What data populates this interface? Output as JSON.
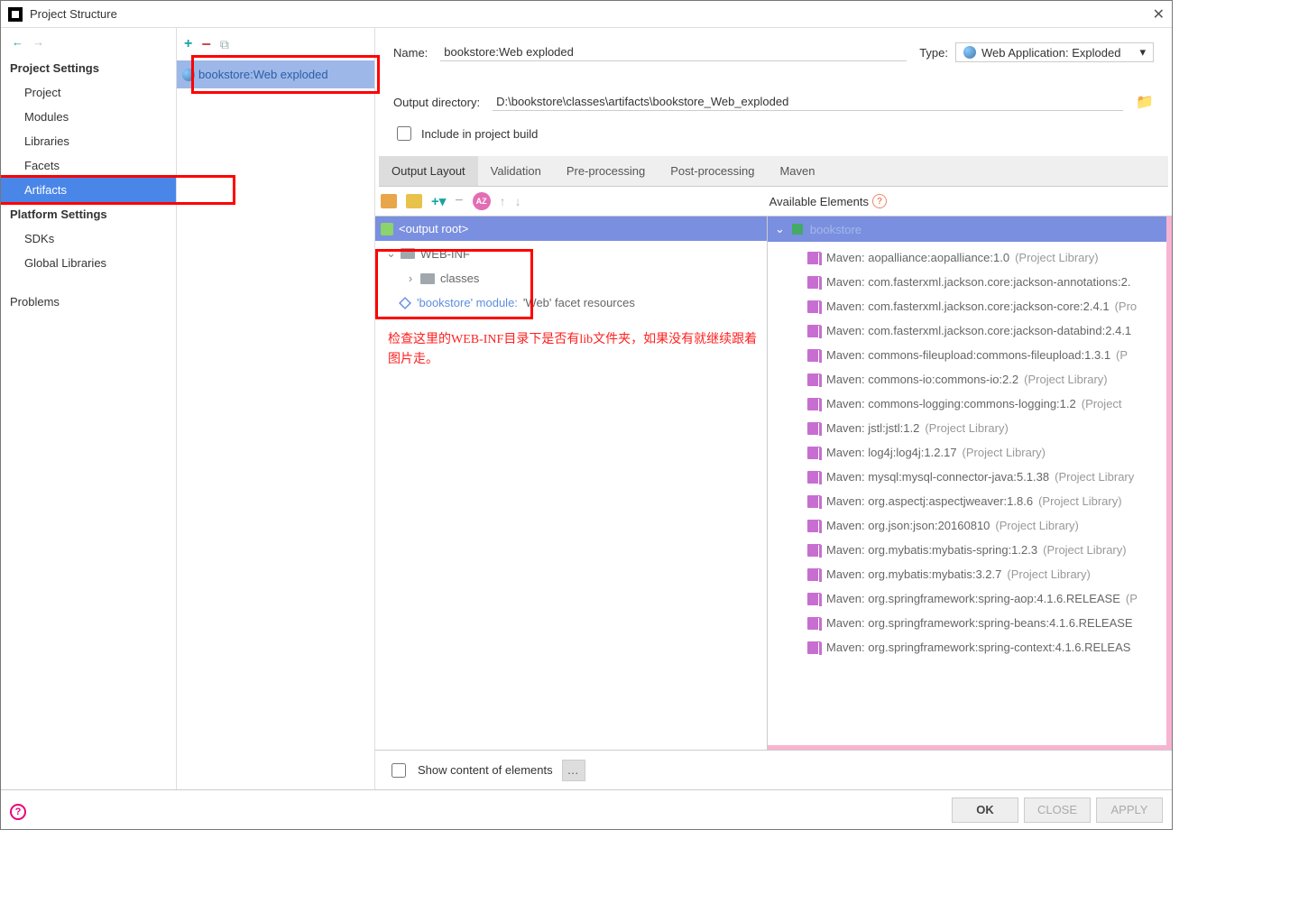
{
  "window_title": "Project Structure",
  "sidebar": {
    "sections": [
      {
        "header": "Project Settings",
        "items": [
          "Project",
          "Modules",
          "Libraries",
          "Facets",
          "Artifacts"
        ],
        "selected": "Artifacts"
      },
      {
        "header": "Platform Settings",
        "items": [
          "SDKs",
          "Global Libraries"
        ]
      },
      {
        "header": "",
        "items": [
          "Problems"
        ]
      }
    ]
  },
  "artifact_list_item": "bookstore:Web exploded",
  "form": {
    "name_label": "Name:",
    "name_value": "bookstore:Web exploded",
    "type_label": "Type:",
    "type_value": "Web Application: Exploded",
    "outdir_label": "Output directory:",
    "outdir_value": "D:\\bookstore\\classes\\artifacts\\bookstore_Web_exploded",
    "include_label": "Include in project build"
  },
  "tabs": [
    "Output Layout",
    "Validation",
    "Pre-processing",
    "Post-processing",
    "Maven"
  ],
  "avail_label": "Available Elements",
  "output_tree": {
    "root": "<output root>",
    "webinf": "WEB-INF",
    "classes": "classes",
    "module_prefix": "'bookstore' module:",
    "module_suffix": " 'Web' facet resources"
  },
  "annotation_text": "检查这里的WEB-INF目录下是否有lib文件夹，如果没有就继续跟着图片走。",
  "right_root": "bookstore",
  "libraries": [
    {
      "n": "Maven: aopalliance:aopalliance:1.0",
      "s": " (Project Library)"
    },
    {
      "n": "Maven: com.fasterxml.jackson.core:jackson-annotations:2.",
      "s": ""
    },
    {
      "n": "Maven: com.fasterxml.jackson.core:jackson-core:2.4.1",
      "s": " (Pro"
    },
    {
      "n": "Maven: com.fasterxml.jackson.core:jackson-databind:2.4.1",
      "s": ""
    },
    {
      "n": "Maven: commons-fileupload:commons-fileupload:1.3.1",
      "s": " (P"
    },
    {
      "n": "Maven: commons-io:commons-io:2.2",
      "s": " (Project Library)"
    },
    {
      "n": "Maven: commons-logging:commons-logging:1.2",
      "s": " (Project"
    },
    {
      "n": "Maven: jstl:jstl:1.2",
      "s": " (Project Library)"
    },
    {
      "n": "Maven: log4j:log4j:1.2.17",
      "s": " (Project Library)"
    },
    {
      "n": "Maven: mysql:mysql-connector-java:5.1.38",
      "s": " (Project Library"
    },
    {
      "n": "Maven: org.aspectj:aspectjweaver:1.8.6",
      "s": " (Project Library)"
    },
    {
      "n": "Maven: org.json:json:20160810",
      "s": " (Project Library)"
    },
    {
      "n": "Maven: org.mybatis:mybatis-spring:1.2.3",
      "s": " (Project Library)"
    },
    {
      "n": "Maven: org.mybatis:mybatis:3.2.7",
      "s": " (Project Library)"
    },
    {
      "n": "Maven: org.springframework:spring-aop:4.1.6.RELEASE",
      "s": " (P"
    },
    {
      "n": "Maven: org.springframework:spring-beans:4.1.6.RELEASE",
      "s": ""
    },
    {
      "n": "Maven: org.springframework:spring-context:4.1.6.RELEAS",
      "s": ""
    }
  ],
  "lower_checkbox": "Show content of elements",
  "buttons": {
    "ok": "OK",
    "close": "CLOSE",
    "apply": "APPLY"
  }
}
